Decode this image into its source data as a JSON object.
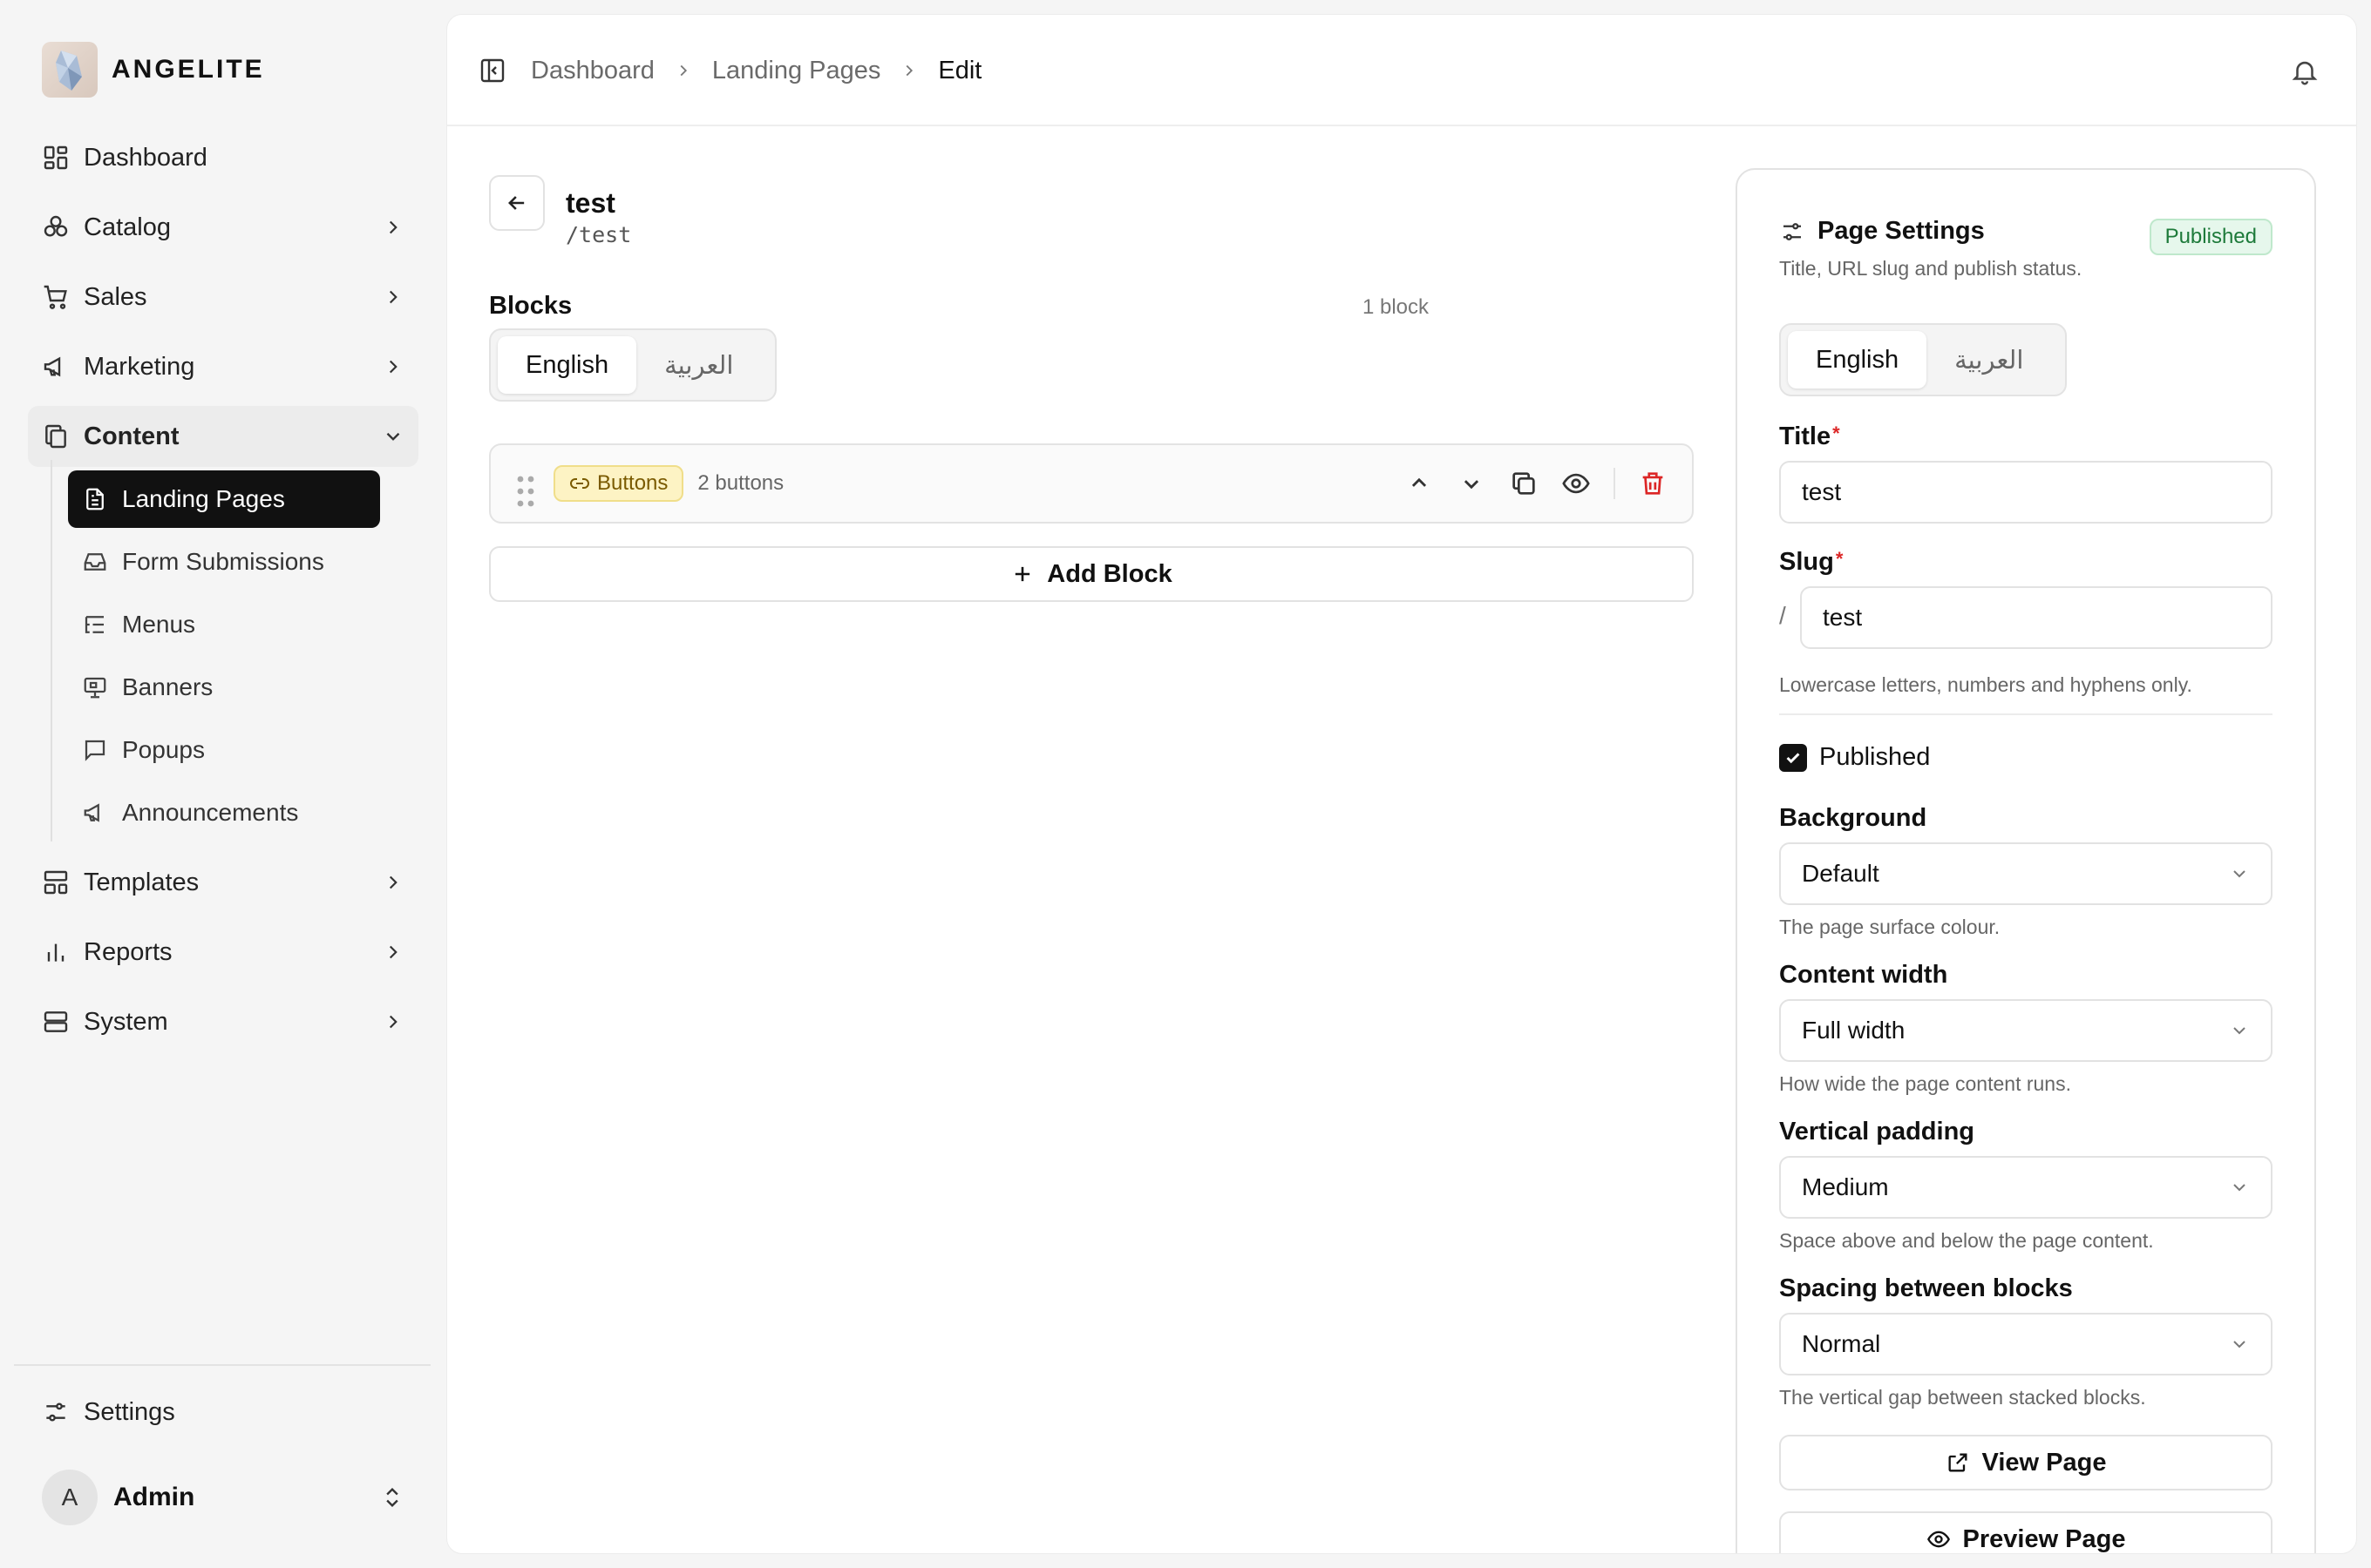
{
  "brand": {
    "name": "ANGELITE"
  },
  "sidebar": {
    "items": [
      {
        "label": "Dashboard",
        "icon": "dashboard-icon"
      },
      {
        "label": "Catalog",
        "icon": "catalog-icon"
      },
      {
        "label": "Sales",
        "icon": "cart-icon"
      },
      {
        "label": "Marketing",
        "icon": "megaphone-icon"
      },
      {
        "label": "Content",
        "icon": "copy-icon"
      },
      {
        "label": "Templates",
        "icon": "templates-icon"
      },
      {
        "label": "Reports",
        "icon": "bar-chart-icon"
      },
      {
        "label": "System",
        "icon": "server-icon"
      }
    ],
    "content_children": [
      {
        "label": "Landing Pages",
        "icon": "file-text-icon",
        "active": true
      },
      {
        "label": "Form Submissions",
        "icon": "inbox-icon"
      },
      {
        "label": "Menus",
        "icon": "list-tree-icon"
      },
      {
        "label": "Banners",
        "icon": "presentation-icon"
      },
      {
        "label": "Popups",
        "icon": "message-square-icon"
      },
      {
        "label": "Announcements",
        "icon": "megaphone-icon"
      }
    ],
    "settings_label": "Settings",
    "user": {
      "name": "Admin",
      "initial": "A"
    }
  },
  "header": {
    "breadcrumbs": [
      "Dashboard",
      "Landing Pages",
      "Edit"
    ]
  },
  "page": {
    "title": "test",
    "slug_display": "/test"
  },
  "blocks": {
    "heading": "Blocks",
    "count": "1 block",
    "languages": [
      "English",
      "العربية"
    ],
    "selected_language": "English",
    "items": [
      {
        "type": "Buttons",
        "summary": "2 buttons"
      }
    ],
    "add_label": "Add Block"
  },
  "settings": {
    "title": "Page Settings",
    "subtitle": "Title, URL slug and publish status.",
    "status": "Published",
    "languages": [
      "English",
      "العربية"
    ],
    "title_label": "Title",
    "title_value": "test",
    "slug_label": "Slug",
    "slug_prefix": "/",
    "slug_value": "test",
    "slug_hint": "Lowercase letters, numbers and hyphens only.",
    "published_label": "Published",
    "published_checked": true,
    "background_label": "Background",
    "background_value": "Default",
    "background_hint": "The page surface colour.",
    "width_label": "Content width",
    "width_value": "Full width",
    "width_hint": "How wide the page content runs.",
    "padding_label": "Vertical padding",
    "padding_value": "Medium",
    "padding_hint": "Space above and below the page content.",
    "spacing_label": "Spacing between blocks",
    "spacing_value": "Normal",
    "spacing_hint": "The vertical gap between stacked blocks.",
    "view_label": "View Page",
    "preview_label": "Preview Page"
  },
  "colors": {
    "active_nav": "#111111",
    "published_badge": "#1d7a3a",
    "block_badge": "#fdf3c4",
    "danger": "#dc2626"
  }
}
